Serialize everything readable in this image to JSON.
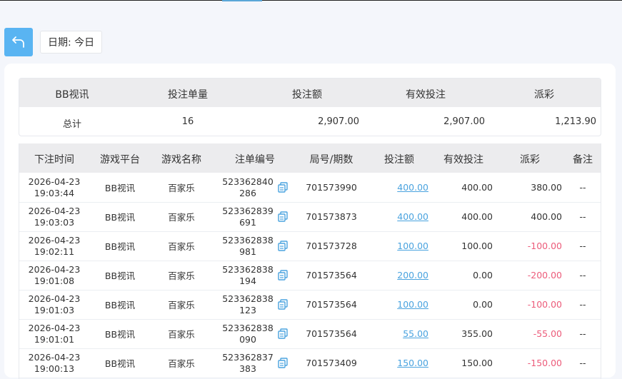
{
  "colors": {
    "accent": "#59b4f2",
    "link": "#4aa3df",
    "negative": "#ec5b7a",
    "header_bg": "#ececee"
  },
  "toolbar": {
    "back_icon": "return-arrow-icon",
    "date_label": "日期: 今日"
  },
  "summary": {
    "headers": [
      "BB视讯",
      "投注单量",
      "投注额",
      "有效投注",
      "派彩"
    ],
    "row": {
      "label": "总计",
      "count": "16",
      "bet": "2,907.00",
      "valid": "2,907.00",
      "payout": "1,213.90"
    }
  },
  "table": {
    "headers": [
      "下注时间",
      "游戏平台",
      "游戏名称",
      "注单编号",
      "局号/期数",
      "投注额",
      "有效投注",
      "派彩",
      "备注"
    ],
    "rows": [
      {
        "date": "2026-04-23",
        "time": "19:03:44",
        "platform": "BB视讯",
        "game": "百家乐",
        "id1": "523362840",
        "id2": "286",
        "round": "701573990",
        "bet": "400.00",
        "valid": "400.00",
        "payout": "380.00",
        "negative": false,
        "note": "--"
      },
      {
        "date": "2026-04-23",
        "time": "19:03:03",
        "platform": "BB视讯",
        "game": "百家乐",
        "id1": "523362839",
        "id2": "691",
        "round": "701573873",
        "bet": "400.00",
        "valid": "400.00",
        "payout": "400.00",
        "negative": false,
        "note": "--"
      },
      {
        "date": "2026-04-23",
        "time": "19:02:11",
        "platform": "BB视讯",
        "game": "百家乐",
        "id1": "523362838",
        "id2": "981",
        "round": "701573728",
        "bet": "100.00",
        "valid": "100.00",
        "payout": "-100.00",
        "negative": true,
        "note": "--"
      },
      {
        "date": "2026-04-23",
        "time": "19:01:08",
        "platform": "BB视讯",
        "game": "百家乐",
        "id1": "523362838",
        "id2": "194",
        "round": "701573564",
        "bet": "200.00",
        "valid": "0.00",
        "payout": "-200.00",
        "negative": true,
        "note": "--"
      },
      {
        "date": "2026-04-23",
        "time": "19:01:03",
        "platform": "BB视讯",
        "game": "百家乐",
        "id1": "523362838",
        "id2": "123",
        "round": "701573564",
        "bet": "100.00",
        "valid": "0.00",
        "payout": "-100.00",
        "negative": true,
        "note": "--"
      },
      {
        "date": "2026-04-23",
        "time": "19:01:01",
        "platform": "BB视讯",
        "game": "百家乐",
        "id1": "523362838",
        "id2": "090",
        "round": "701573564",
        "bet": "55.00",
        "valid": "355.00",
        "payout": "-55.00",
        "negative": true,
        "note": "--"
      },
      {
        "date": "2026-04-23",
        "time": "19:00:13",
        "platform": "BB视讯",
        "game": "百家乐",
        "id1": "523362837",
        "id2": "383",
        "round": "701573409",
        "bet": "150.00",
        "valid": "150.00",
        "payout": "-150.00",
        "negative": true,
        "note": "--"
      }
    ]
  }
}
